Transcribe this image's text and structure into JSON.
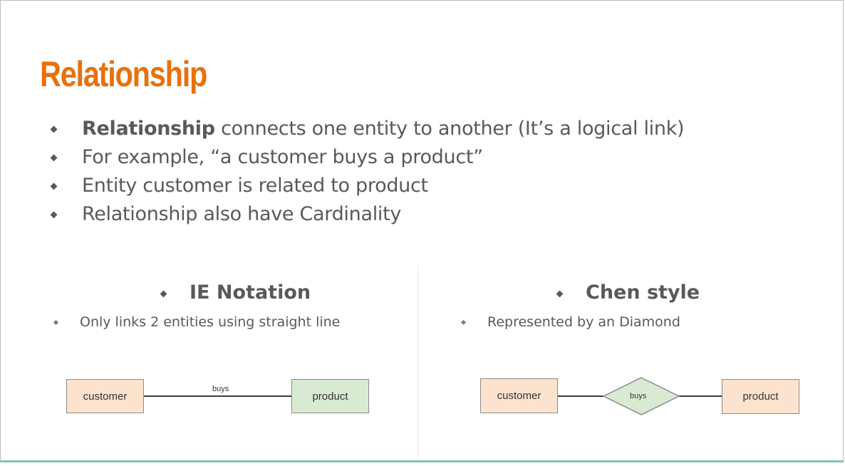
{
  "slide": {
    "title": "Relationship",
    "bullets": [
      {
        "bold": "Relationship",
        "text": " connects one entity to another (It’s a logical link)"
      },
      {
        "bold": "",
        "text": "For example, “a customer buys a product”"
      },
      {
        "bold": "",
        "text": "Entity customer is related to product"
      },
      {
        "bold": "",
        "text": "Relationship also have Cardinality"
      }
    ],
    "ie": {
      "heading": "IE Notation",
      "note": "Only links 2 entities using straight line",
      "entity_left": "customer",
      "relationship": "buys",
      "entity_right": "product"
    },
    "chen": {
      "heading": "Chen style",
      "note": "Represented by an Diamond",
      "entity_left": "customer",
      "relationship": "buys",
      "entity_right": "product"
    }
  },
  "colors": {
    "title": "#e8710a",
    "text": "#595959",
    "entity_orange": "#fde3cd",
    "entity_green": "#d9ead3",
    "bottom_accent": "#7fc6a8"
  }
}
